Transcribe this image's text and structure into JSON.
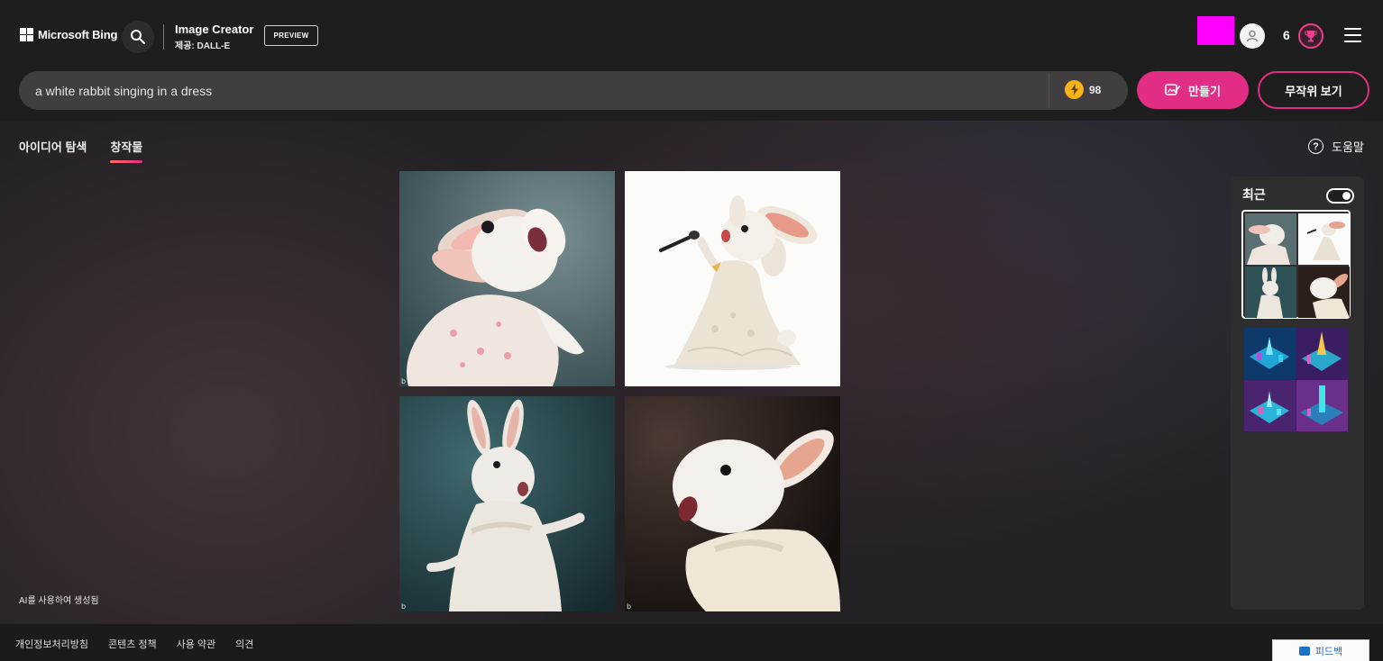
{
  "header": {
    "logo_text": "Microsoft Bing",
    "app_title": "Image Creator",
    "app_subtitle": "제공: DALL-E",
    "preview_badge": "PREVIEW",
    "reward_count": "6"
  },
  "prompt": {
    "value": "a white rabbit singing in a dress",
    "boost_count": "98"
  },
  "buttons": {
    "create": "만들기",
    "surprise": "무작위 보기"
  },
  "tabs": [
    {
      "label": "아이디어 탐색",
      "active": false
    },
    {
      "label": "창작물",
      "active": true
    }
  ],
  "help_label": "도움말",
  "ai_generated_label": "AI를 사용하여 생성됨",
  "sidebar": {
    "title": "최근",
    "toggle_on": true
  },
  "footer": {
    "links": [
      "개인정보처리방침",
      "콘텐츠 정책",
      "사용 약관",
      "의견"
    ],
    "feedback_label": "피드백"
  },
  "icons": {
    "search": "search-icon",
    "avatar": "user-avatar-icon",
    "reward": "trophy-icon",
    "menu": "hamburger-menu-icon",
    "boost": "lightning-coin-icon",
    "create": "create-image-icon",
    "help": "help-circle-icon"
  },
  "colors": {
    "accent": "#e22d84",
    "boost_coin": "#f7b318",
    "topbar": "#1f1e1e",
    "redacted_block": "#ff00ff"
  }
}
